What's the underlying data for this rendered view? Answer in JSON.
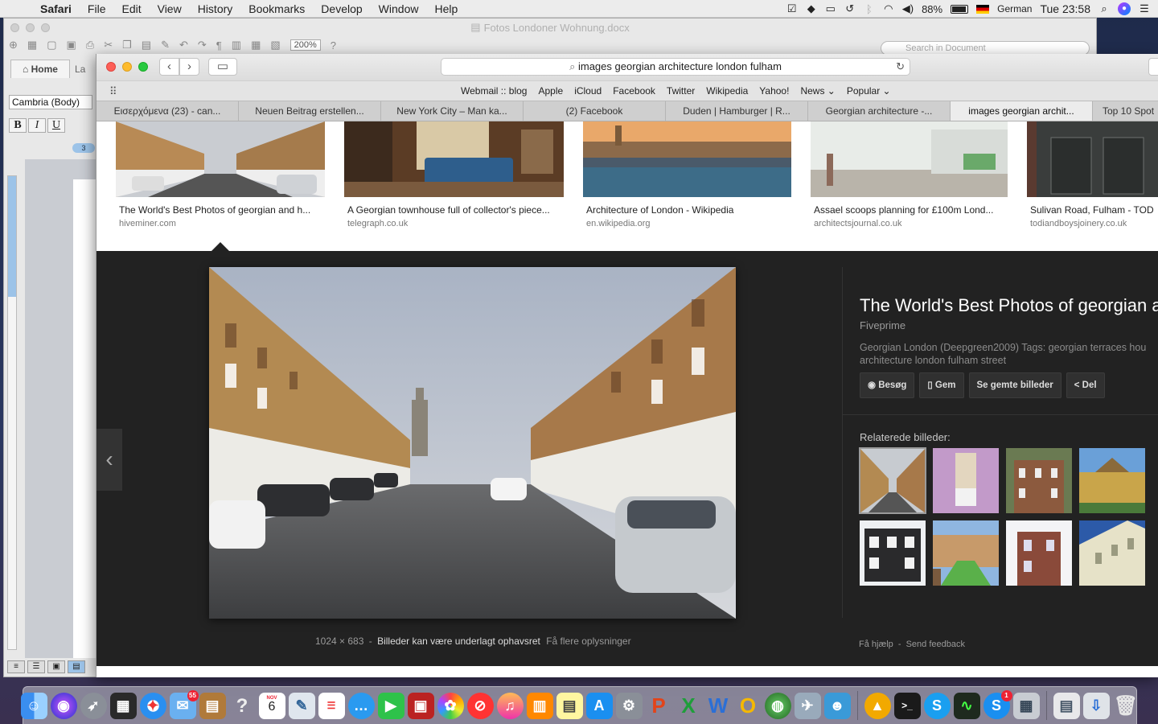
{
  "menubar": {
    "app_name": "Safari",
    "menus": [
      "File",
      "Edit",
      "View",
      "History",
      "Bookmarks",
      "Develop",
      "Window",
      "Help"
    ],
    "battery": "88%",
    "input_source": "German",
    "clock": "Tue 23:58"
  },
  "word": {
    "title": "Fotos Londoner Wohnung.docx",
    "zoom": "200%",
    "search_placeholder": "Search in Document",
    "tab_home": "Home",
    "tab_next": "La",
    "font_name": "Cambria (Body)",
    "bold": "B",
    "italic": "I",
    "underline": "U",
    "indent_value": "3"
  },
  "safari": {
    "address": "images georgian architecture london fulham",
    "favorites": [
      "Webmail :: blog",
      "Apple",
      "iCloud",
      "Facebook",
      "Twitter",
      "Wikipedia",
      "Yahoo!",
      "News ⌄",
      "Popular ⌄"
    ],
    "tabs": [
      {
        "label": "Εισερχόμενα (23) - can...",
        "active": false
      },
      {
        "label": "Neuen Beitrag erstellen...",
        "active": false
      },
      {
        "label": "New York City – Man ka...",
        "active": false
      },
      {
        "label": "(2) Facebook",
        "active": false
      },
      {
        "label": "Duden | Hamburger | R...",
        "active": false
      },
      {
        "label": "Georgian architecture -...",
        "active": false
      },
      {
        "label": "images georgian archit...",
        "active": true
      },
      {
        "label": "Top 10 Spot",
        "active": false
      }
    ]
  },
  "results": [
    {
      "title": "The World's Best Photos of georgian and h...",
      "site": "hiveminer.com"
    },
    {
      "title": "A Georgian townhouse full of collector's piece...",
      "site": "telegraph.co.uk"
    },
    {
      "title": "Architecture of London - Wikipedia",
      "site": "en.wikipedia.org"
    },
    {
      "title": "Assael scoops planning for £100m Lond...",
      "site": "architectsjournal.co.uk"
    },
    {
      "title": "Sulivan Road, Fulham - TOD",
      "site": "todiandboysjoinery.co.uk"
    }
  ],
  "viewer": {
    "title": "The World's Best Photos of georgian a",
    "source": "Fiveprime",
    "description_line1": "Georgian London (Deepgreen2009) Tags: georgian terraces hou",
    "description_line2": "architecture london fulham street",
    "buttons": [
      "Besøg",
      "Gem",
      "Se gemte billeder",
      "Del"
    ],
    "related_label": "Relaterede billeder:",
    "dimensions": "1024 × 683",
    "separator": "-",
    "license": "Billeder kan være underlagt ophavsret",
    "more_info": "Få flere oplysninger",
    "help": "Få hjælp",
    "feedback": "Send feedback"
  },
  "dock": {
    "calendar_month": "NOV",
    "calendar_day": "6",
    "mail_badge": "55",
    "skype_badge": "1"
  }
}
